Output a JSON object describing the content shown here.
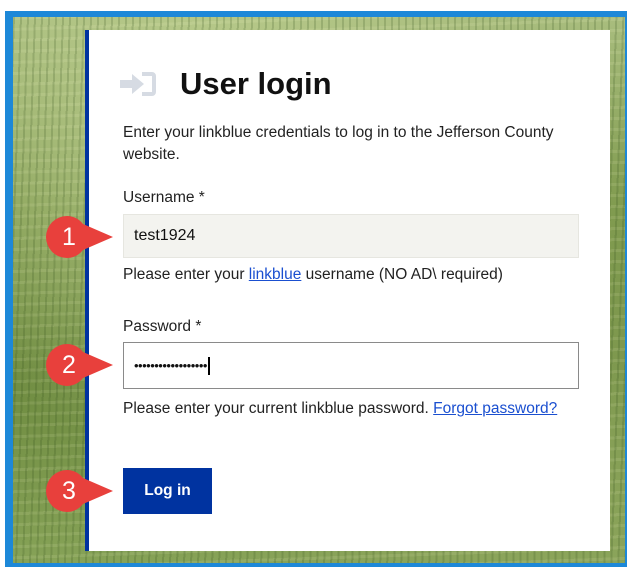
{
  "login": {
    "title": "User login",
    "intro": "Enter your linkblue credentials to log in to the Jefferson County website.",
    "username_label": "Username *",
    "username_value": "test1924",
    "username_help_prefix": "Please enter your ",
    "username_help_link": "linkblue",
    "username_help_suffix": " username (NO AD\\ required)",
    "password_label": "Password *",
    "password_value": "••••••••••••••••••",
    "password_help_prefix": "Please enter your current linkblue password. ",
    "password_help_link": "Forgot password?",
    "login_button": "Log in",
    "icon": "login-arrow-icon"
  },
  "callouts": [
    {
      "number": "1"
    },
    {
      "number": "2"
    },
    {
      "number": "3"
    }
  ],
  "colors": {
    "frame": "#1d88d8",
    "accent": "#0033a0",
    "callout": "#e8403c",
    "link": "#1a4fd0"
  }
}
